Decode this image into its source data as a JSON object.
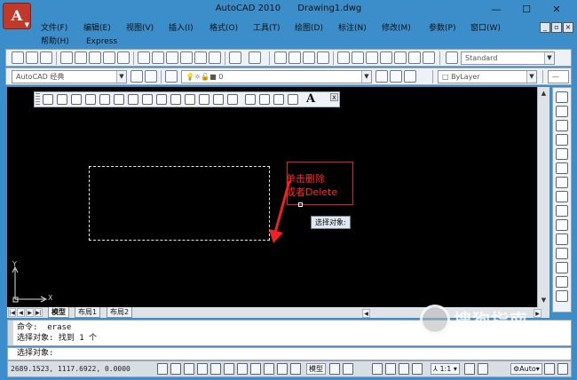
{
  "window": {
    "app_name": "AutoCAD 2010",
    "doc_name": "Drawing1.dwg",
    "app_button_letter": "A",
    "minimize_glyph": "—",
    "maximize_glyph": "☐",
    "close_glyph": "✕"
  },
  "menu": {
    "row1": [
      "文件(F)",
      "编辑(E)",
      "视图(V)",
      "插入(I)",
      "格式(O)",
      "工具(T)",
      "绘图(D)",
      "标注(N)",
      "修改(M)",
      "参数(P)",
      "窗口(W)"
    ],
    "row2": [
      "帮助(H)",
      "Express"
    ],
    "mdi_controls": [
      "_",
      "▫",
      "×"
    ]
  },
  "toolbars": {
    "text_style_value": "Standard",
    "workspace_value": "AutoCAD 经典",
    "layer_value": "0",
    "color_value": "ByLayer",
    "text_style_icon": "text-style-icon",
    "layer_state_icon": "lightbulb-icon"
  },
  "draw_toolbar": {
    "text_tool_label": "A",
    "close_glyph": "x",
    "icons": [
      "line-icon",
      "construction-line-icon",
      "polyline-icon",
      "polygon-icon",
      "rectangle-icon",
      "arc-icon",
      "circle-icon",
      "revision-cloud-icon",
      "spline-icon",
      "ellipse-icon",
      "ellipse-arc-icon",
      "insert-block-icon",
      "make-block-icon",
      "point-icon",
      "hatch-icon",
      "gradient-icon",
      "region-icon",
      "table-icon"
    ]
  },
  "canvas": {
    "annotation_line1": "单击删除",
    "annotation_line2": "或者Delete",
    "tooltip": "选择对象:",
    "ucs_x_label": "X",
    "ucs_y_label": "Y"
  },
  "layout_tabs": {
    "tabs": [
      "模型",
      "布局1",
      "布局2"
    ],
    "active_tab": "模型",
    "nav_glyphs": [
      "|◀",
      "◀",
      "▶",
      "▶|"
    ]
  },
  "command": {
    "history": [
      "命令:  erase",
      "选择对象: 找到 1 个"
    ],
    "prompt": "选择对象:"
  },
  "status": {
    "coords": "2689.1523, 1117.6922, 0.0000",
    "model_label": "模型",
    "annotation_scale": "1:1",
    "workspace_label": "Auto"
  },
  "watermark": {
    "text": "搜狗指南",
    "url": "zhinan.sogou.com"
  },
  "colors": {
    "title_bar": "#3c8ecb",
    "canvas_bg": "#000000",
    "annotation_red": "#ff2b2b",
    "app_button": "#c0392b"
  }
}
